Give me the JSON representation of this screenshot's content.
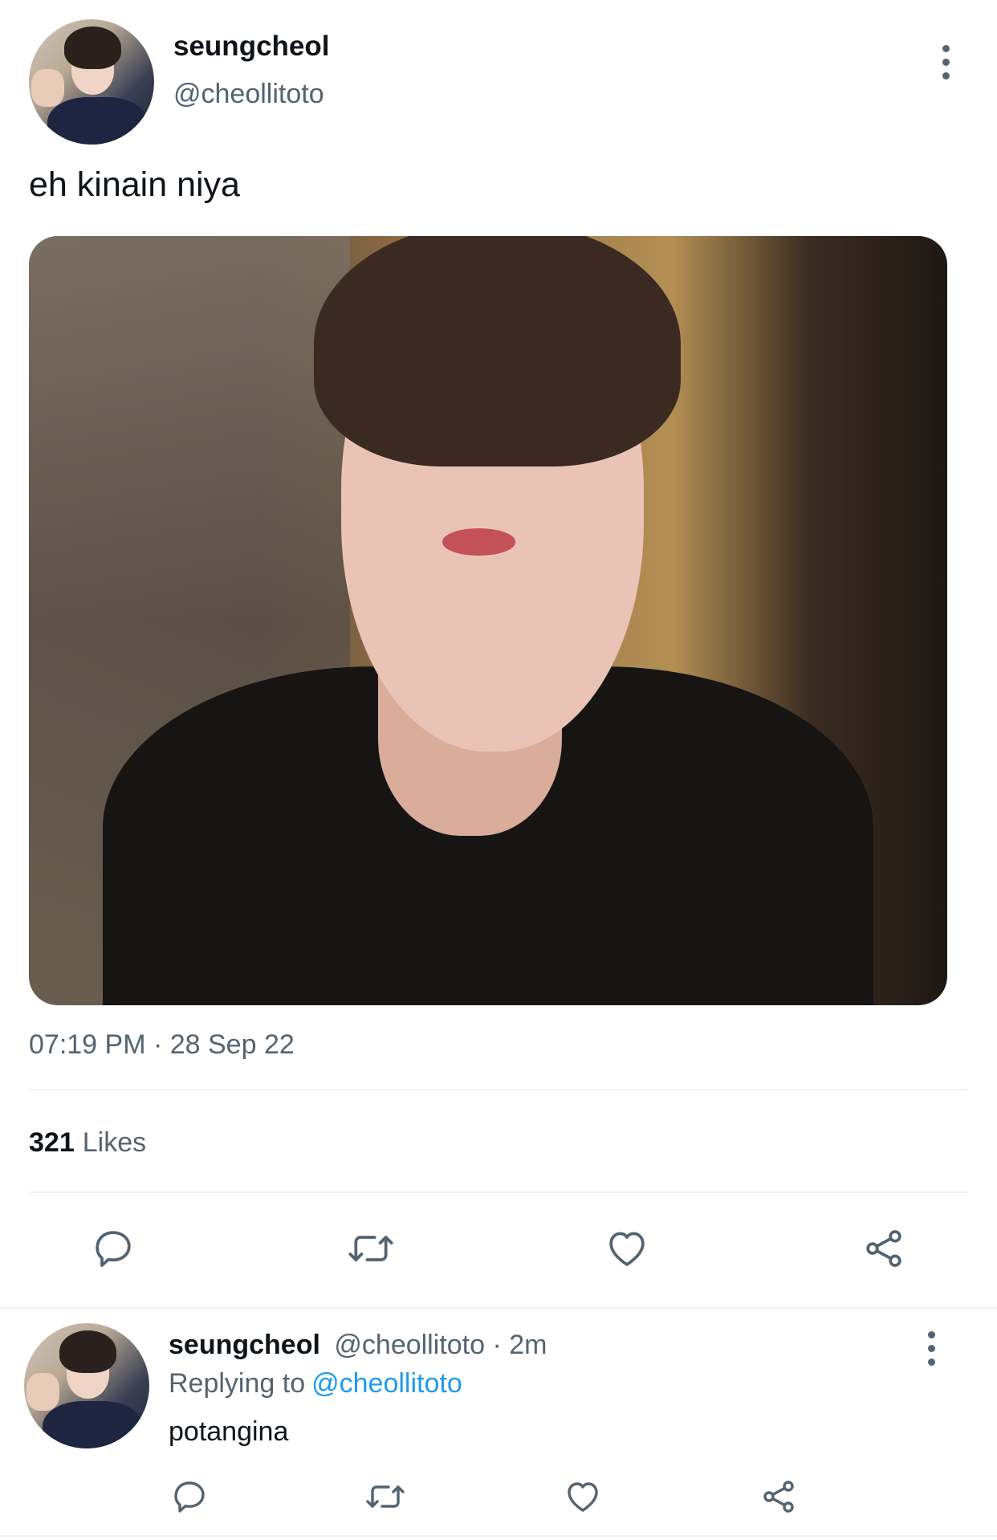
{
  "tweet": {
    "author_name": "seungcheol",
    "author_handle": "@cheollitoto",
    "text": "eh kinain niya",
    "timestamp": "07:19 PM · 28 Sep 22",
    "likes_count": "321",
    "likes_label": "Likes",
    "icons": {
      "reply": "comment-icon",
      "retweet": "retweet-icon",
      "like": "heart-icon",
      "share": "share-icon",
      "more": "more-vertical-icon"
    }
  },
  "reply": {
    "author_name": "seungcheol",
    "author_handle": "@cheollitoto",
    "separator": "·",
    "time": "2m",
    "replying_label": "Replying to",
    "replying_mention": "@cheollitoto",
    "text": "potangina"
  },
  "colors": {
    "text_primary": "#0f1419",
    "text_secondary": "#536471",
    "accent": "#1d9bf0",
    "divider": "#eff3f4"
  }
}
